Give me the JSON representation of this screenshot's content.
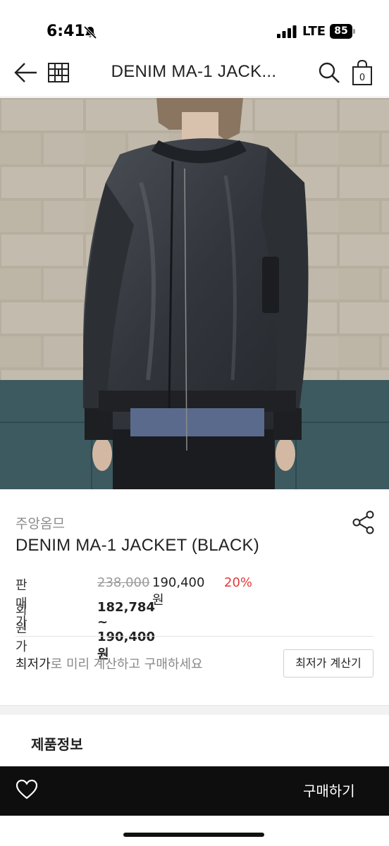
{
  "status_bar": {
    "time": "6:41",
    "network": "LTE",
    "battery": "85"
  },
  "header": {
    "title": "DENIM MA-1 JACK..."
  },
  "product": {
    "image_icon": "product-photo-denim-jacket",
    "brand": "주앙옴므",
    "name": "DENIM MA-1 JACKET (BLACK)",
    "price_label": "판매가",
    "price_original": "238,000",
    "price_current": "190,400 원",
    "discount": "20%",
    "member_label": "회원가",
    "member_price": "182,784 ~ 190,400 원"
  },
  "lowest_price": {
    "text_em": "최저가",
    "text_rest": "로 미리 계산하고 구매하세요",
    "button_label": "최저가 계산기"
  },
  "tabs": {
    "product_info": "제품정보"
  },
  "bottom_bar": {
    "buy_label": "구매하기"
  },
  "colors": {
    "discount": "#e03a3a",
    "bottom_bar": "#0e0e0e"
  }
}
